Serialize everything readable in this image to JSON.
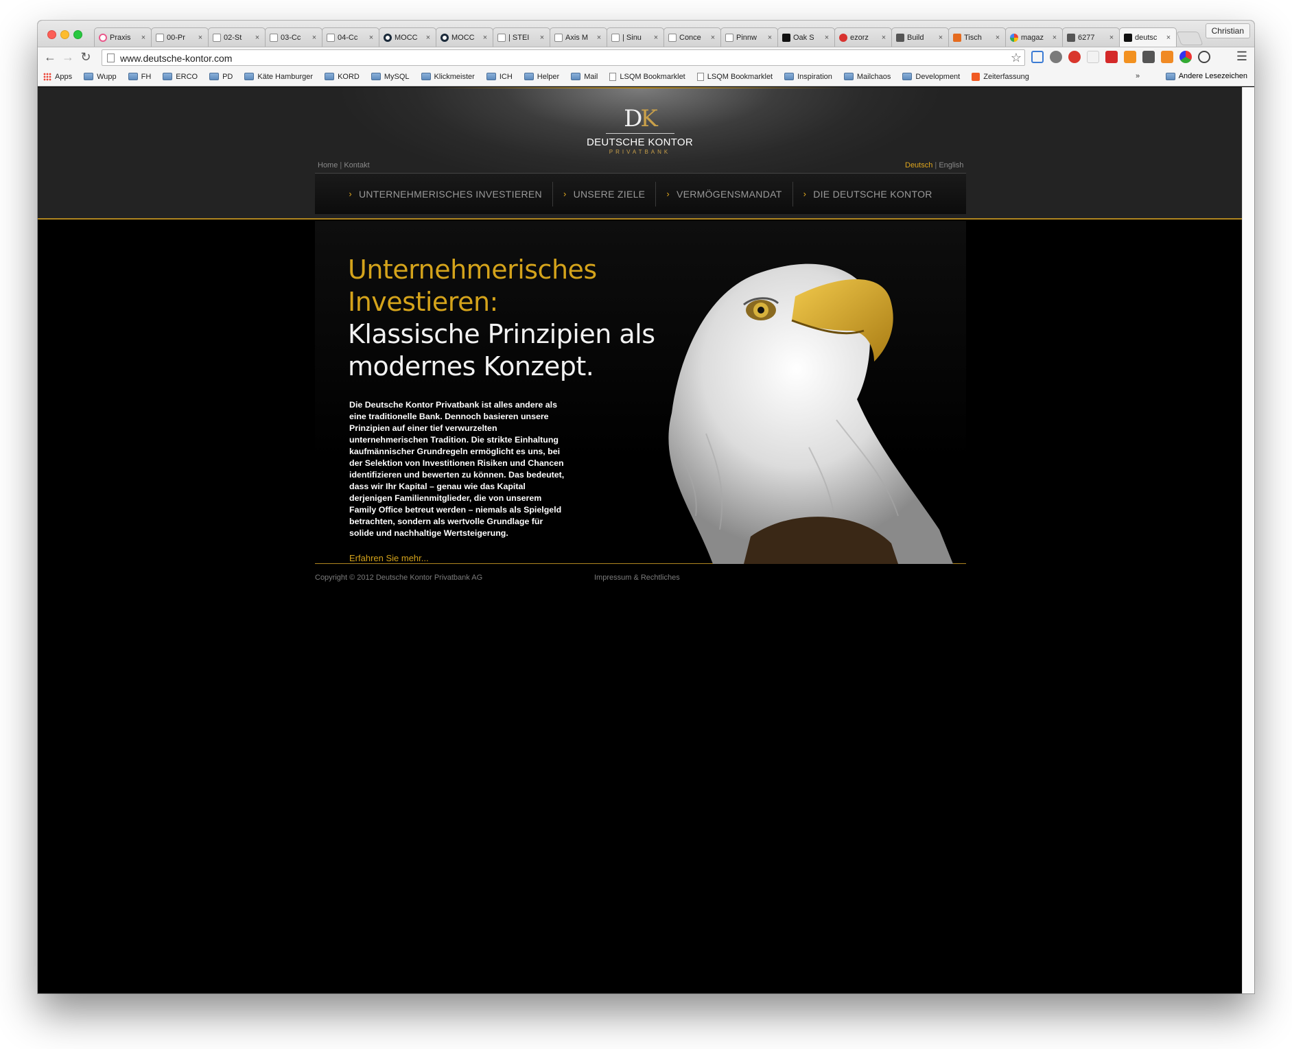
{
  "browser": {
    "tabs": [
      {
        "title": "Praxis",
        "icon": "pink-circle-icon"
      },
      {
        "title": "00-Pr",
        "icon": "page-icon"
      },
      {
        "title": "02-St",
        "icon": "page-icon"
      },
      {
        "title": "03-Cc",
        "icon": "page-icon"
      },
      {
        "title": "04-Cc",
        "icon": "page-icon"
      },
      {
        "title": "MOCC",
        "icon": "eye-icon"
      },
      {
        "title": "MOCC",
        "icon": "eye-icon"
      },
      {
        "title": "| STEI",
        "icon": "page-icon"
      },
      {
        "title": "Axis M",
        "icon": "page-icon"
      },
      {
        "title": "| Sinu",
        "icon": "page-icon"
      },
      {
        "title": "Conce",
        "icon": "page-icon"
      },
      {
        "title": "Pinnw",
        "icon": "page-icon"
      },
      {
        "title": "Oak S",
        "icon": "black-icon"
      },
      {
        "title": "ezorz",
        "icon": "red-circle-icon"
      },
      {
        "title": "Build",
        "icon": "gray-icon"
      },
      {
        "title": "Tisch",
        "icon": "orange-icon"
      },
      {
        "title": "magaz",
        "icon": "google-icon"
      },
      {
        "title": "6277",
        "icon": "gray-icon"
      },
      {
        "title": "deutsc",
        "icon": "dk-icon",
        "active": true
      }
    ],
    "profile_name": "Christian",
    "url": "www.deutsche-kontor.com",
    "bookmarks": [
      {
        "label": "Apps",
        "icon": "apps"
      },
      {
        "label": "Wupp",
        "icon": "folder"
      },
      {
        "label": "FH",
        "icon": "folder"
      },
      {
        "label": "ERCO",
        "icon": "folder"
      },
      {
        "label": "PD",
        "icon": "folder"
      },
      {
        "label": "Käte Hamburger",
        "icon": "folder"
      },
      {
        "label": "KORD",
        "icon": "folder"
      },
      {
        "label": "MySQL",
        "icon": "folder"
      },
      {
        "label": "Klickmeister",
        "icon": "folder"
      },
      {
        "label": "ICH",
        "icon": "folder"
      },
      {
        "label": "Helper",
        "icon": "folder"
      },
      {
        "label": "Mail",
        "icon": "folder"
      },
      {
        "label": "LSQM Bookmarklet",
        "icon": "page"
      },
      {
        "label": "LSQM Bookmarklet",
        "icon": "page"
      },
      {
        "label": "Inspiration",
        "icon": "folder"
      },
      {
        "label": "Mailchaos",
        "icon": "folder"
      },
      {
        "label": "Development",
        "icon": "folder"
      },
      {
        "label": "Zeiterfassung",
        "icon": "orange"
      }
    ],
    "bookmarks_more": "»",
    "other_bookmarks": "Andere Lesezeichen"
  },
  "site": {
    "logo": {
      "mark_d": "D",
      "mark_k": "K",
      "name": "DEUTSCHE KONTOR",
      "sub": "PRIVATBANK"
    },
    "util_left": {
      "home": "Home",
      "sep": "|",
      "contact": "Kontakt"
    },
    "util_right": {
      "lang_de": "Deutsch",
      "sep": "|",
      "lang_en": "English"
    },
    "nav": [
      "UNTERNEHMERISCHES INVESTIEREN",
      "UNSERE ZIELE",
      "VERMÖGENSMANDAT",
      "DIE DEUTSCHE KONTOR"
    ],
    "hero": {
      "title_gold_1": "Unternehmerisches",
      "title_gold_2": "Investieren:",
      "title_white_1": "Klassische Prinzipien als",
      "title_white_2": "modernes Konzept.",
      "body": "Die Deutsche Kontor Privatbank ist alles andere als eine traditionelle Bank. Dennoch basieren unsere Prinzipien auf einer tief verwurzelten unternehmerischen Tradition. Die strikte Einhaltung kaufmännischer Grundregeln ermöglicht es uns, bei der Selektion von Investitionen Risiken und Chancen identifizieren und bewerten zu können. Das bedeutet, dass wir Ihr Kapital – genau wie das Kapital derjenigen Familienmitglieder, die von unserem Family Office betreut werden – niemals als Spielgeld betrachten, sondern als wertvolle Grundlage für solide und nachhaltige Wertsteigerung.",
      "more_link": "Erfahren Sie mehr..."
    },
    "footer": {
      "copyright": "Copyright © 2012 Deutsche Kontor Privatbank AG",
      "impressum": "Impressum & Rechtliches"
    }
  },
  "colors": {
    "gold": "#d4a31b",
    "nav_text": "#9a9a9a",
    "header_line": "#b08620"
  }
}
